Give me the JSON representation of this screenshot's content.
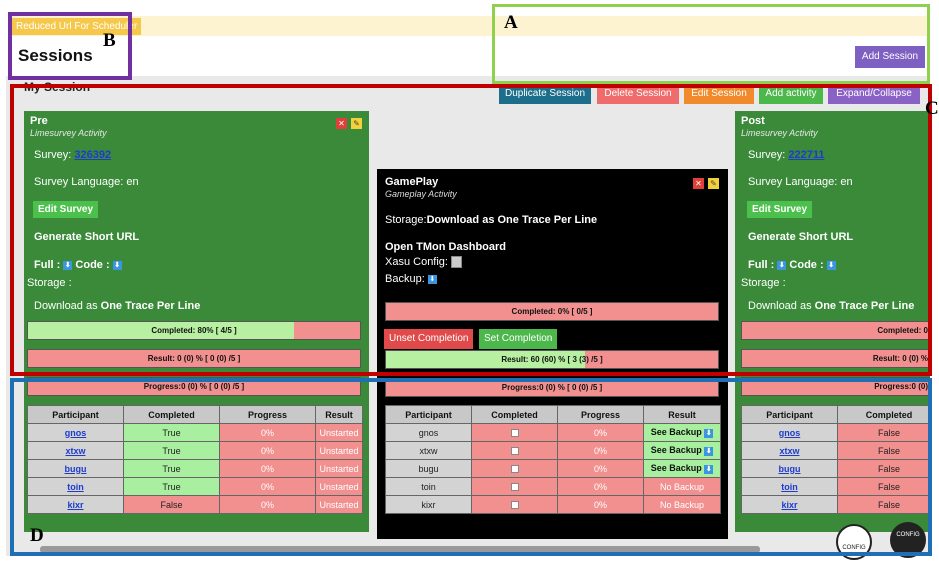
{
  "header": {
    "reduced_url": "Reduced Url For Scheduler",
    "title": "Sessions",
    "add_session": "Add Session"
  },
  "session": {
    "label": "My Session"
  },
  "toolbar": {
    "duplicate": "Duplicate Session",
    "delete": "Delete Session",
    "edit": "Edit Session",
    "add_activity": "Add activity",
    "expand": "Expand/Collapse"
  },
  "colors": {
    "activity_green": "#3a8a3a",
    "gameplay_black": "#000000",
    "progress_green": "#b6f0a0",
    "progress_red": "#f29090",
    "add_session_purple": "#7e5fc2"
  },
  "pre": {
    "title": "Pre",
    "subtitle": "Limesurvey Activity",
    "survey_label": "Survey:",
    "survey_id": "326392",
    "language": "Survey Language: en",
    "edit_survey": "Edit Survey",
    "short_url": "Generate Short URL",
    "full": "Full :",
    "code": "Code :",
    "storage": "Storage :",
    "download_prefix": "Download as",
    "download_bold": "One Trace Per Line",
    "completed": "Completed: 80% [ 4/5 ]",
    "completed_fraction": 0.8,
    "result": "Result: 0 (0) % [ 0 (0) /5 ]",
    "progress": "Progress:0 (0) % [ 0 (0) /5 ]",
    "headers": [
      "Participant",
      "Completed",
      "Progress",
      "Result"
    ],
    "rows": [
      {
        "name": "gnos",
        "completed": "True",
        "progress": "0%",
        "result": "Unstarted"
      },
      {
        "name": "xtxw",
        "completed": "True",
        "progress": "0%",
        "result": "Unstarted"
      },
      {
        "name": "bugu",
        "completed": "True",
        "progress": "0%",
        "result": "Unstarted"
      },
      {
        "name": "toin",
        "completed": "True",
        "progress": "0%",
        "result": "Unstarted"
      },
      {
        "name": "kixr",
        "completed": "False",
        "progress": "0%",
        "result": "Unstarted"
      }
    ]
  },
  "gameplay": {
    "title": "GamePlay",
    "subtitle": "Gameplay Activity",
    "storage_prefix": "Storage:",
    "storage_bold": "Download as One Trace Per Line",
    "dashboard": "Open TMon Dashboard",
    "xasu": "Xasu Config:",
    "backup": "Backup:",
    "completed": "Completed: 0% [ 0/5 ]",
    "completed_fraction": 0,
    "unset": "Unset Completion",
    "set": "Set Completion",
    "result": "Result: 60 (60) % [ 3 (3) /5 ]",
    "result_fraction": 0.6,
    "progress": "Progress:0 (0) % [ 0 (0) /5 ]",
    "headers": [
      "Participant",
      "Completed",
      "Progress",
      "Result"
    ],
    "rows": [
      {
        "name": "gnos",
        "progress": "0%",
        "result": "See Backup"
      },
      {
        "name": "xtxw",
        "progress": "0%",
        "result": "See Backup"
      },
      {
        "name": "bugu",
        "progress": "0%",
        "result": "See Backup"
      },
      {
        "name": "toin",
        "progress": "0%",
        "result": "No Backup"
      },
      {
        "name": "kixr",
        "progress": "0%",
        "result": "No Backup"
      }
    ]
  },
  "post": {
    "title": "Post",
    "subtitle": "Limesurvey Activity",
    "survey_label": "Survey:",
    "survey_id": "222711",
    "language": "Survey Language: en",
    "edit_survey": "Edit Survey",
    "short_url": "Generate Short URL",
    "full": "Full :",
    "code": "Code :",
    "storage": "Storage :",
    "download_prefix": "Download as",
    "download_bold": "One Trace Per Line",
    "completed": "Completed: 0",
    "result": "Result: 0 (0) %",
    "progress": "Progress:0 (0)",
    "headers": [
      "Participant",
      "Completed"
    ],
    "rows": [
      {
        "name": "gnos",
        "completed": "False"
      },
      {
        "name": "xtxw",
        "completed": "False"
      },
      {
        "name": "bugu",
        "completed": "False"
      },
      {
        "name": "toin",
        "completed": "False"
      },
      {
        "name": "kixr",
        "completed": "False"
      }
    ]
  },
  "annotations": {
    "a": "A",
    "b": "B",
    "c": "C",
    "d": "D"
  },
  "bottom_icons": {
    "left": "CONFIG",
    "right": "CONFIG"
  }
}
